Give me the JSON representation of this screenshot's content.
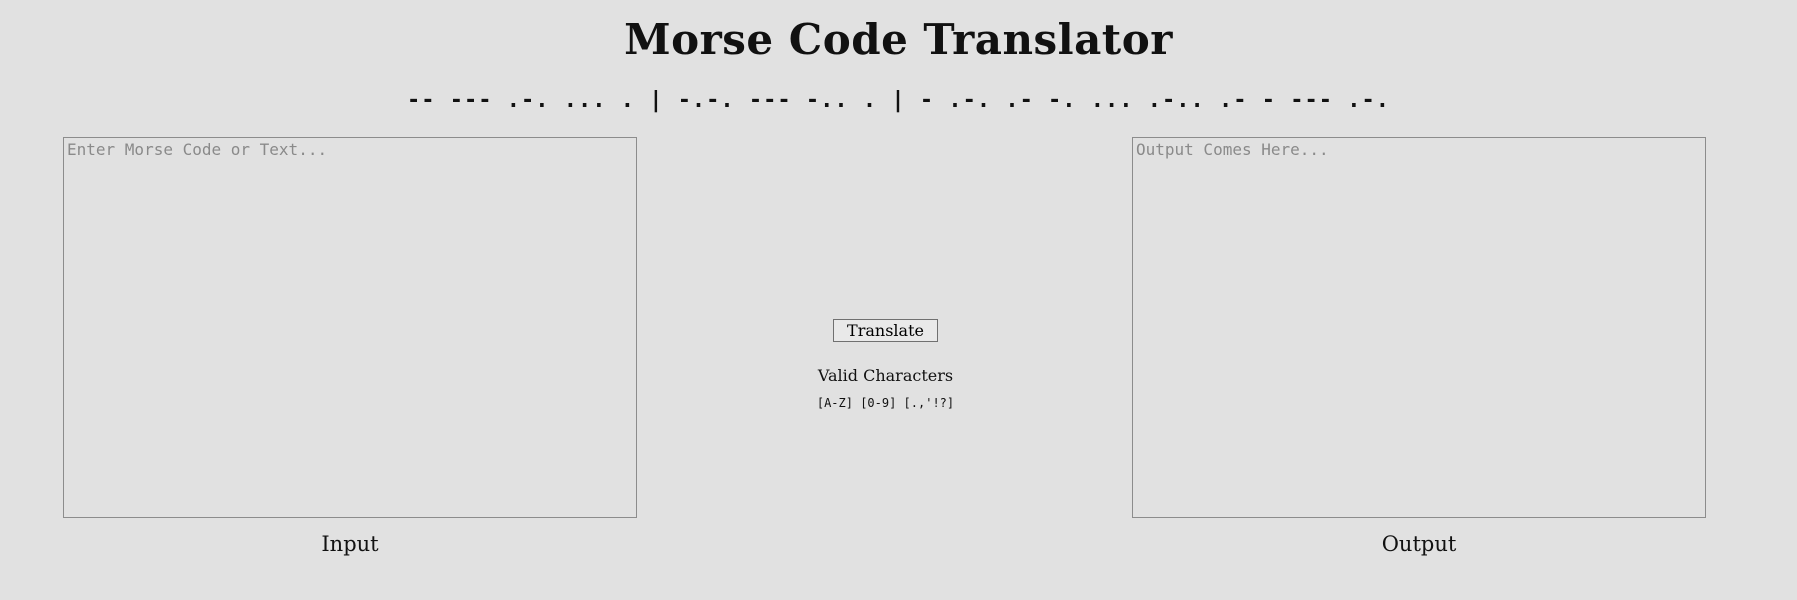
{
  "header": {
    "title": "Morse Code Translator",
    "morse_subtitle": "-- --- .-. ... . | -.-. --- -.. . | - .-. .- -. ... .-.. .- - --- .-."
  },
  "input": {
    "placeholder": "Enter Morse Code or Text...",
    "value": "",
    "label": "Input"
  },
  "output": {
    "placeholder": "Output Comes Here...",
    "value": "",
    "label": "Output"
  },
  "controls": {
    "translate_label": "Translate",
    "valid_title": "Valid Characters",
    "valid_chars": "[A-Z] [0-9] [.,'!?]"
  }
}
